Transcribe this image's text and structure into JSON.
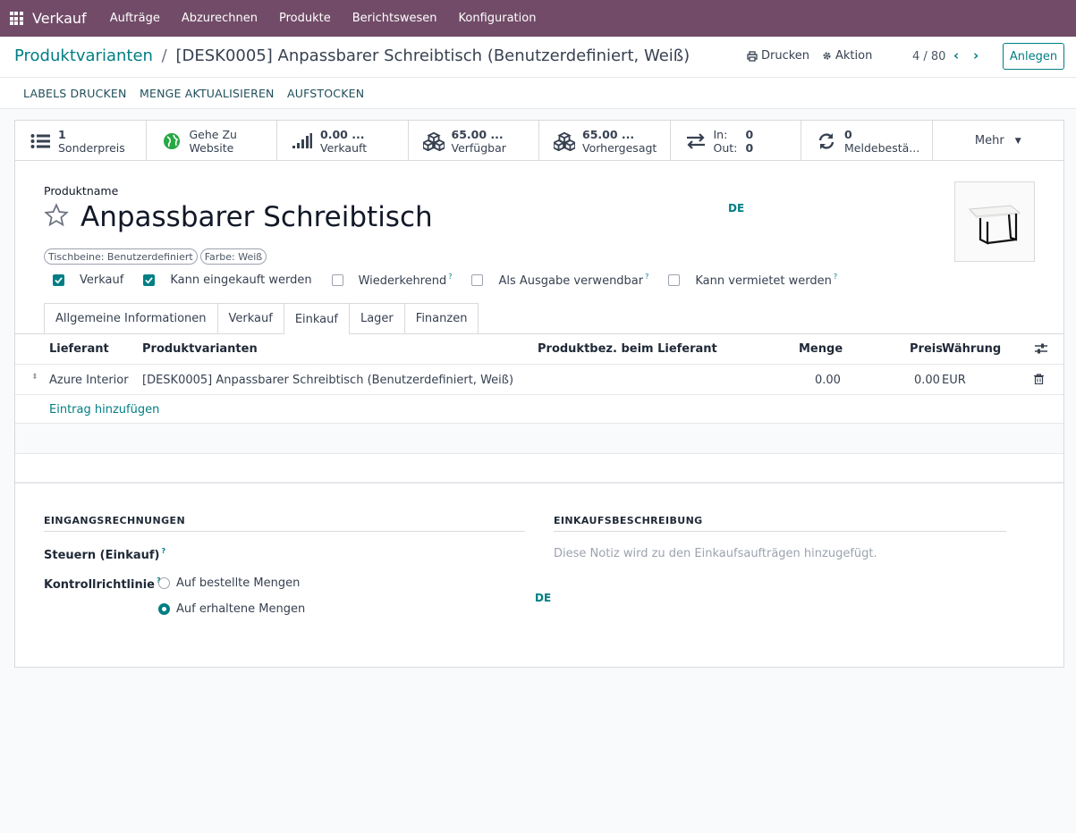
{
  "topnav": {
    "app_name": "Verkauf",
    "menu": [
      "Aufträge",
      "Abzurechnen",
      "Produkte",
      "Berichtswesen",
      "Konfiguration"
    ]
  },
  "control_panel": {
    "breadcrumb_parent": "Produktvarianten",
    "breadcrumb_separator": "/",
    "breadcrumb_current": "[DESK0005] Anpassbarer Schreibtisch (Benutzerdefiniert, Weiß)",
    "print_label": "Drucken",
    "action_label": "Aktion",
    "pager": "4 / 80",
    "create_label": "Anlegen"
  },
  "statusbar": {
    "buttons": [
      "LABELS DRUCKEN",
      "MENGE AKTUALISIEREN",
      "AUFSTOCKEN"
    ]
  },
  "smart_buttons": {
    "pricelist": {
      "value": "1",
      "label": "Sonderpreis"
    },
    "website": {
      "line1": "Gehe Zu",
      "line2": "Website"
    },
    "sold": {
      "value": "0.00 ...",
      "label": "Verkauft"
    },
    "available": {
      "value": "65.00 ...",
      "label": "Verfügbar"
    },
    "forecast": {
      "value": "65.00 ...",
      "label": "Vorhergesagt"
    },
    "inout": {
      "in_label": "In:",
      "in_value": "0",
      "out_label": "Out:",
      "out_value": "0"
    },
    "reorder": {
      "value": "0",
      "label": "Meldebestä..."
    },
    "more_label": "Mehr"
  },
  "form": {
    "name_label": "Produktname",
    "name": "Anpassbarer Schreibtisch",
    "lang_badge": "DE",
    "tags": [
      "Tischbeine: Benutzerdefiniert",
      "Farbe: Weiß"
    ],
    "checkboxes": [
      {
        "label": "Verkauf",
        "checked": true,
        "help": false
      },
      {
        "label": "Kann eingekauft werden",
        "checked": true,
        "help": false
      },
      {
        "label": "Wiederkehrend",
        "checked": false,
        "help": true
      },
      {
        "label": "Als Ausgabe verwendbar",
        "checked": false,
        "help": true
      },
      {
        "label": "Kann vermietet werden",
        "checked": false,
        "help": true
      }
    ],
    "help_mark": "?",
    "tabs": [
      "Allgemeine Informationen",
      "Verkauf",
      "Einkauf",
      "Lager",
      "Finanzen"
    ],
    "active_tab": "Einkauf"
  },
  "vendor_table": {
    "headers": [
      "Lieferant",
      "Produktvarianten",
      "Produktbez. beim Lieferant",
      "Menge",
      "Preis",
      "Währung"
    ],
    "rows": [
      {
        "vendor": "Azure Interior",
        "variant": "[DESK0005] Anpassbarer Schreibtisch (Benutzerdefiniert, Weiß)",
        "vendor_name": "",
        "qty": "0.00",
        "price": "0.00",
        "currency": "EUR"
      }
    ],
    "add_line": "Eintrag hinzufügen"
  },
  "purchase": {
    "bills_title": "EINGANGSRECHNUNGEN",
    "taxes_label": "Steuern (Einkauf)",
    "control_label": "Kontrollrichtlinie",
    "control_options": [
      {
        "label": "Auf bestellte Mengen",
        "selected": false
      },
      {
        "label": "Auf erhaltene Mengen",
        "selected": true
      }
    ],
    "lang_badge": "DE",
    "desc_title": "EINKAUFSBESCHREIBUNG",
    "desc_placeholder": "Diese Notiz wird zu den Einkaufsaufträgen hinzugefügt."
  },
  "colors": {
    "brand": "#714b67",
    "accent": "#017e84"
  }
}
